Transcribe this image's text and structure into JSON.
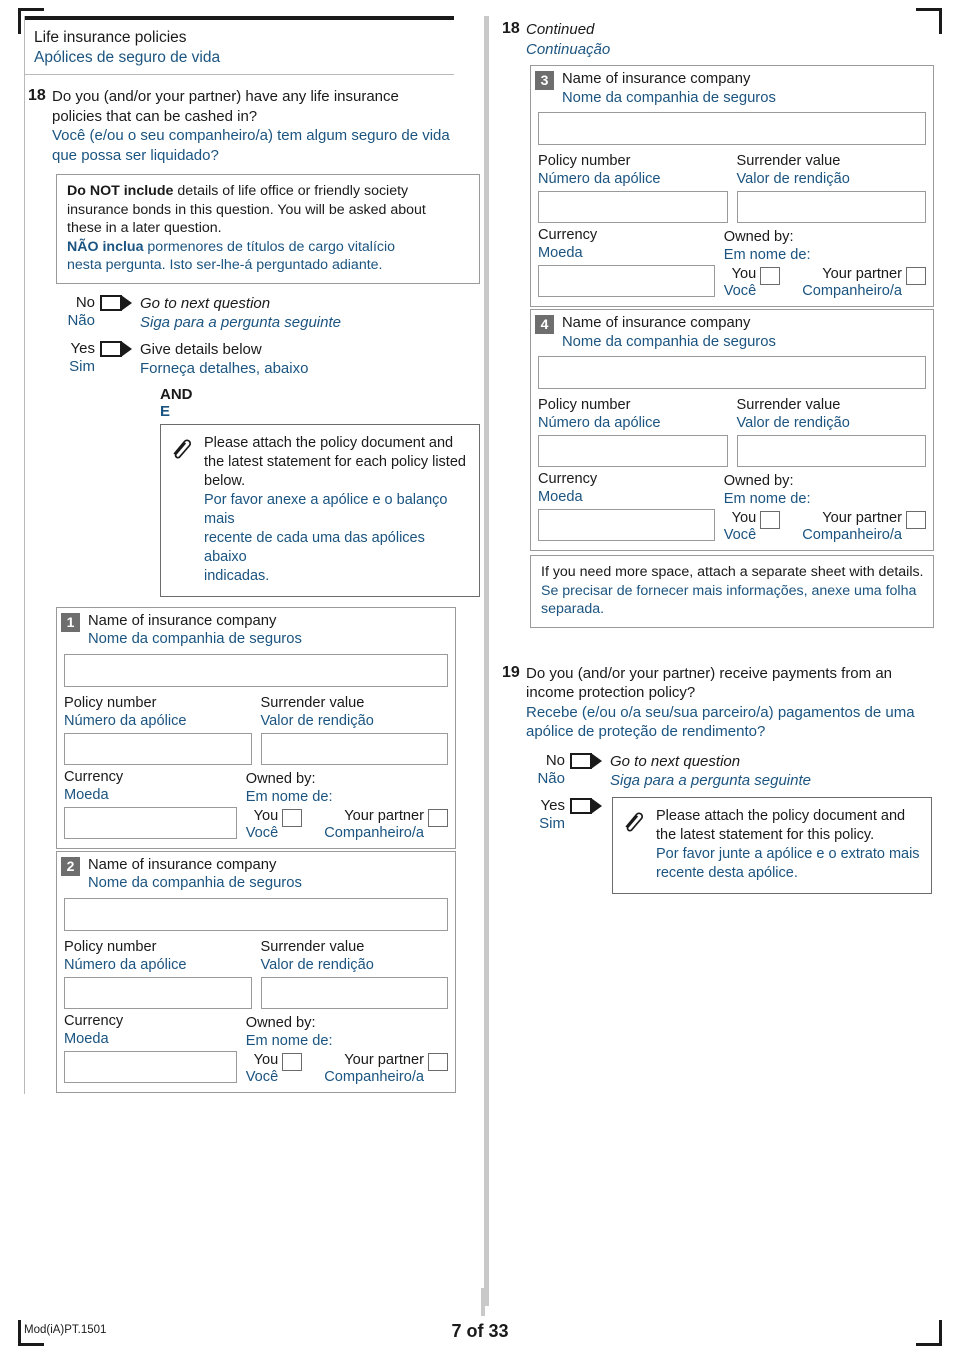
{
  "document": {
    "form_code": "Mod(iA)PT.1501",
    "page_label": "7 of 33",
    "accent_blue": "#1b5480",
    "badge_gray": "#6e6e6e"
  },
  "left_column": {
    "section_header": {
      "en": "Life insurance policies",
      "pt": "Apólices de seguro de vida"
    },
    "question18": {
      "number": "18",
      "en_line1": "Do you (and/or your partner) have any life insurance",
      "en_line2": "policies that can be cashed in?",
      "pt_line1": "Você (e/ou o seu companheiro/a) tem algum seguro de vida",
      "pt_line2": "que possa ser liquidado?",
      "note": {
        "en_bold": "Do NOT include",
        "en_rest1": " details of life office or friendly society",
        "en_line2": "insurance bonds in this question. You will be asked about",
        "en_line3": "these in a later question.",
        "pt_bold": "NÃO inclua",
        "pt_rest1": " pormenores de títulos de cargo vitalício",
        "pt_line2": "nesta pergunta. Isto ser-lhe-á perguntado adiante."
      },
      "answers": {
        "no_en": "No",
        "no_pt": "Não",
        "no_action_en": "Go to next question",
        "no_action_pt": "Siga para a pergunta seguinte",
        "yes_en": "Yes",
        "yes_pt": "Sim",
        "yes_action_en": "Give details below",
        "yes_action_pt": "Forneça detalhes, abaixo"
      },
      "and_en": "AND",
      "and_pt": "E",
      "attach_note": {
        "icon": "paperclip-icon",
        "en_line1": "Please attach the policy document and",
        "en_line2": "the latest statement for each policy listed",
        "en_line3": "below.",
        "pt_line1": "Por favor anexe a apólice e o balanço mais",
        "pt_line2": "recente de cada uma das apólices abaixo",
        "pt_line3": "indicadas."
      }
    },
    "policy_blocks": [
      {
        "number": "1",
        "company_label_en": "Name of insurance company",
        "company_label_pt": "Nome da companhia de seguros",
        "company_value": "",
        "policy_number_label_en": "Policy number",
        "policy_number_label_pt": "Número da apólice",
        "policy_number_value": "",
        "surrender_label_en": "Surrender value",
        "surrender_label_pt": "Valor de rendição",
        "surrender_value": "",
        "currency_label_en": "Currency",
        "currency_label_pt": "Moeda",
        "currency_value": "",
        "owned_label_en": "Owned by:",
        "owned_label_pt": "Em nome de:",
        "owner_you_en": "You",
        "owner_you_pt": "Você",
        "owner_partner_en": "Your partner",
        "owner_partner_pt": "Companheiro/a"
      },
      {
        "number": "2",
        "company_label_en": "Name of insurance company",
        "company_label_pt": "Nome da companhia de seguros",
        "company_value": "",
        "policy_number_label_en": "Policy number",
        "policy_number_label_pt": "Número da apólice",
        "policy_number_value": "",
        "surrender_label_en": "Surrender value",
        "surrender_label_pt": "Valor de rendição",
        "surrender_value": "",
        "currency_label_en": "Currency",
        "currency_label_pt": "Moeda",
        "currency_value": "",
        "owned_label_en": "Owned by:",
        "owned_label_pt": "Em nome de:",
        "owner_you_en": "You",
        "owner_you_pt": "Você",
        "owner_partner_en": "Your partner",
        "owner_partner_pt": "Companheiro/a"
      }
    ]
  },
  "right_column": {
    "continued": {
      "number": "18",
      "en": "Continued",
      "pt": "Continuação"
    },
    "policy_blocks": [
      {
        "number": "3",
        "company_label_en": "Name of insurance company",
        "company_label_pt": "Nome da companhia de seguros",
        "company_value": "",
        "policy_number_label_en": "Policy number",
        "policy_number_label_pt": "Número da apólice",
        "policy_number_value": "",
        "surrender_label_en": "Surrender value",
        "surrender_label_pt": "Valor de rendição",
        "surrender_value": "",
        "currency_label_en": "Currency",
        "currency_label_pt": "Moeda",
        "currency_value": "",
        "owned_label_en": "Owned by:",
        "owned_label_pt": "Em nome de:",
        "owner_you_en": "You",
        "owner_you_pt": "Você",
        "owner_partner_en": "Your partner",
        "owner_partner_pt": "Companheiro/a"
      },
      {
        "number": "4",
        "company_label_en": "Name of insurance company",
        "company_label_pt": "Nome da companhia de seguros",
        "company_value": "",
        "policy_number_label_en": "Policy number",
        "policy_number_label_pt": "Número da apólice",
        "policy_number_value": "",
        "surrender_label_en": "Surrender value",
        "surrender_label_pt": "Valor de rendição",
        "surrender_value": "",
        "currency_label_en": "Currency",
        "currency_label_pt": "Moeda",
        "currency_value": "",
        "owned_label_en": "Owned by:",
        "owned_label_pt": "Em nome de:",
        "owner_you_en": "You",
        "owner_you_pt": "Você",
        "owner_partner_en": "Your partner",
        "owner_partner_pt": "Companheiro/a"
      }
    ],
    "more_space_note": {
      "en": "If you need more space, attach a separate sheet with details.",
      "pt_line1": "Se precisar de fornecer mais informações, anexe uma folha",
      "pt_line2": "separada."
    },
    "question19": {
      "number": "19",
      "en_line1": "Do you (and/or your partner) receive payments from an",
      "en_line2": "income protection policy?",
      "pt_line1": "Recebe (e/ou o/a seu/sua parceiro/a) pagamentos de uma",
      "pt_line2": "apólice de proteção de rendimento?",
      "answers": {
        "no_en": "No",
        "no_pt": "Não",
        "no_action_en": "Go to next question",
        "no_action_pt": "Siga para a pergunta seguinte",
        "yes_en": "Yes",
        "yes_pt": "Sim"
      },
      "attach_note": {
        "icon": "paperclip-icon",
        "en_line1": "Please attach the policy document and",
        "en_line2": "the latest statement for this policy.",
        "pt_line1": "Por favor junte a apólice e o extrato mais",
        "pt_line2": "recente desta apólice."
      }
    }
  }
}
